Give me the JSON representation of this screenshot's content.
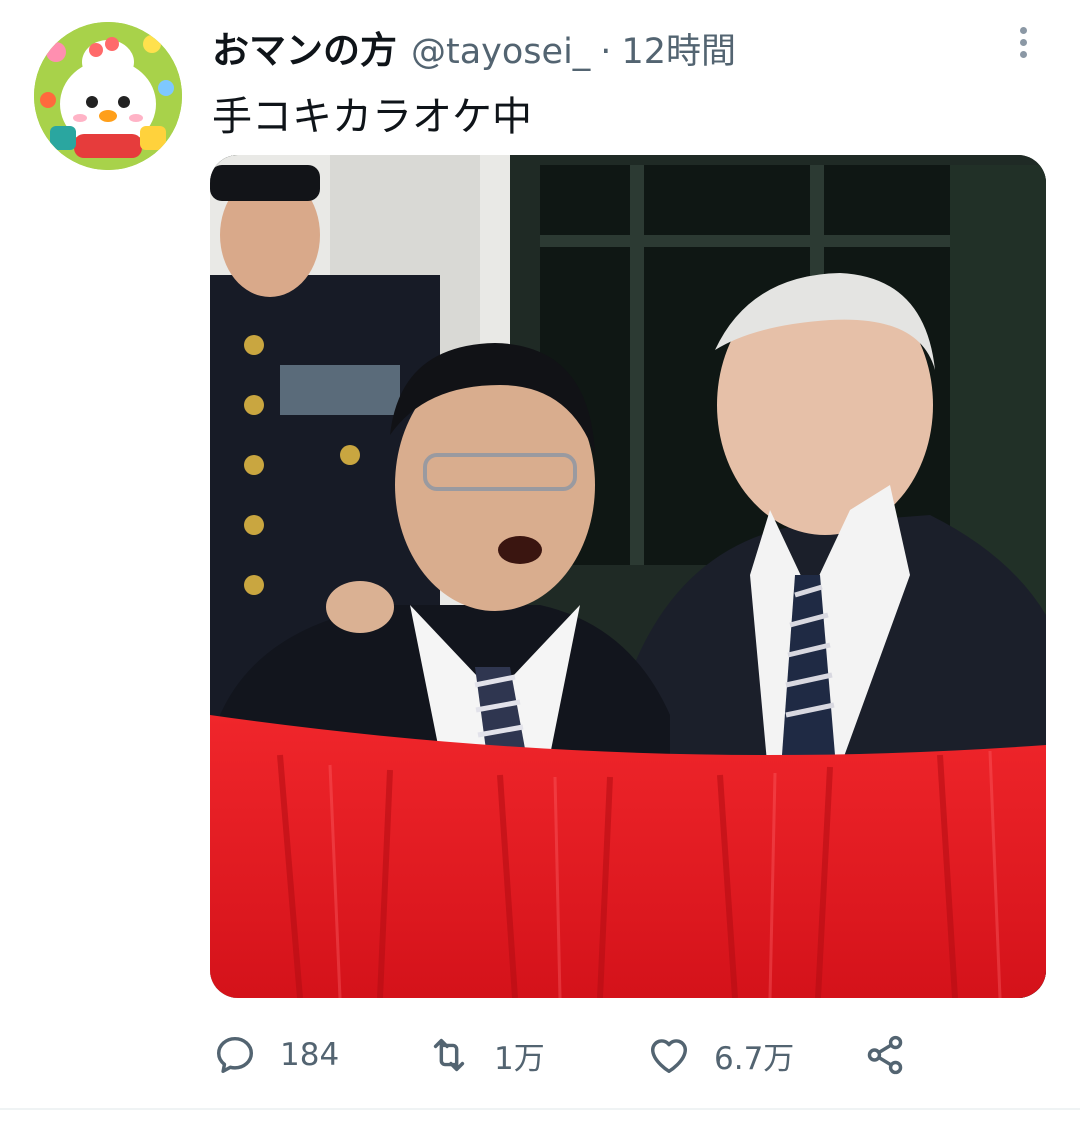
{
  "tweet": {
    "author_name": "おマンの方",
    "handle": "@tayosei_",
    "separator": "·",
    "time": "12時間",
    "text": "手コキカラオケ中"
  },
  "actions": {
    "replies": {
      "icon": "reply-icon",
      "count": "184"
    },
    "retweets": {
      "icon": "retweet-icon",
      "count": "1万"
    },
    "likes": {
      "icon": "heart-icon",
      "count": "6.7万"
    },
    "share": {
      "icon": "share-icon"
    }
  },
  "colors": {
    "text_primary": "#0f1419",
    "text_secondary": "#536471",
    "divider": "#eff3f4",
    "banner_red": "#e0161b"
  }
}
